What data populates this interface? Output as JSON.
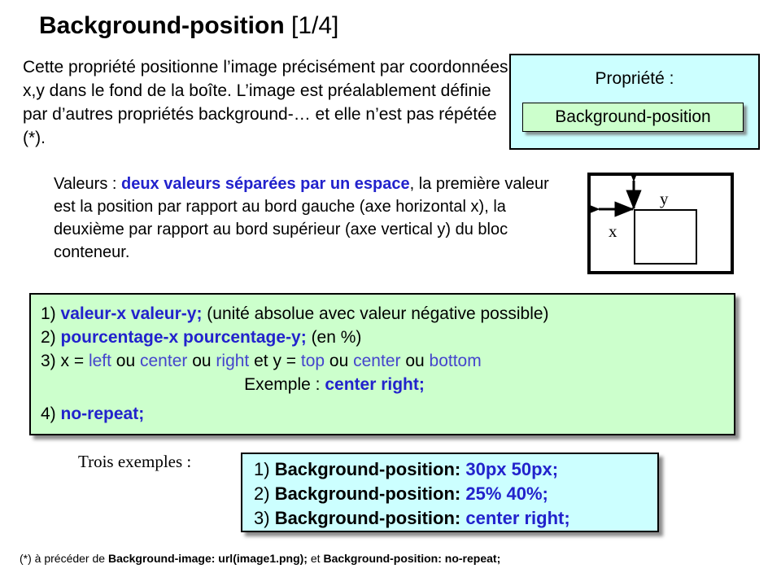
{
  "slide": {
    "title": {
      "main": "Background-position",
      "suffix": "[1/4]"
    },
    "intro": "Cette propriété positionne l’image précisément par coordonnées x,y dans le fond de la boîte. L’image est préalablement définie par d’autres propriétés background-… et elle n’est pas répétée (*).",
    "property_panel": {
      "label": "Propriété :",
      "chip": "Background-position"
    },
    "values_paragraph": {
      "lead": "Valeurs : ",
      "highlight": "deux valeurs séparées par un espace",
      "rest": ", la première valeur est la position par rapport au bord gauche (axe horizontal x), la deuxième par rapport au bord supérieur (axe vertical y) du bloc conteneur."
    },
    "diagram": {
      "x_label": "x",
      "y_label": "y"
    },
    "syntax": {
      "line1": {
        "num": "1) ",
        "code": "valeur-x valeur-y;",
        "note": " (unité absolue avec valeur négative possible)"
      },
      "line2": {
        "num": "2) ",
        "code": "pourcentage-x pourcentage-y;",
        "note": "  (en %)"
      },
      "line3": {
        "num": "3) x = ",
        "kw1": "left",
        "sep1": " ou ",
        "kw2": "center",
        "sep2": " ou ",
        "kw3": "right",
        "mid": " et y = ",
        "kw4": "top",
        "sep3": " ou ",
        "kw5": "center",
        "sep4": " ou ",
        "kw6": "bottom"
      },
      "line4": {
        "label": "Exemple : ",
        "code": "center right;"
      },
      "line5": {
        "num": "4) ",
        "code": "no-repeat;"
      }
    },
    "examples_label": "Trois exemples :",
    "examples": [
      {
        "num": "1) ",
        "property": "Background-position: ",
        "value": "30px 50px;"
      },
      {
        "num": "2) ",
        "property": "Background-position: ",
        "value": "25% 40%;"
      },
      {
        "num": "3) ",
        "property": "Background-position: ",
        "value": "center right;"
      }
    ],
    "footnote": {
      "prefix": "(*) à précéder de ",
      "code1": "Background-image: url(image1.png);",
      "middle": " et ",
      "code2": "Background-position: no-repeat;"
    },
    "colors": {
      "cyan_panel": "#ccffff",
      "green_panel": "#ccffcc",
      "keyword_blue": "#2222cc",
      "keyword_light_blue": "#4444cc",
      "border": "#000000"
    }
  }
}
